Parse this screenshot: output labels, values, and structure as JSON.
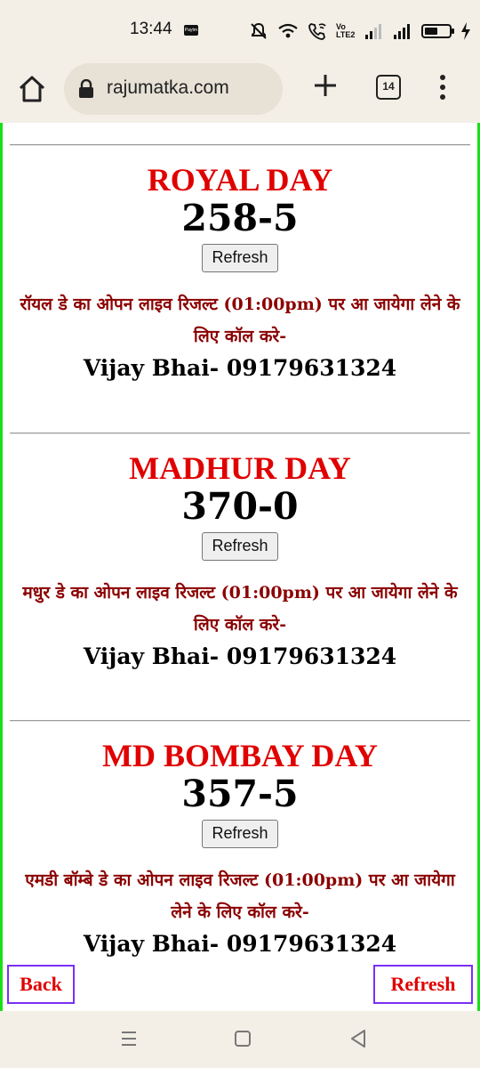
{
  "status_bar": {
    "time": "13:44",
    "paytm_badge": "Paytm",
    "volte": "Vo LTE2",
    "icons": [
      "paytm-icon",
      "mute-icon",
      "wifi-icon",
      "wifi-call-icon",
      "volte-icon",
      "signal-icon",
      "signal-icon",
      "battery-icon",
      "charging-icon"
    ]
  },
  "browser": {
    "url": "rajumatka.com",
    "tab_count": "14",
    "icons": [
      "home-icon",
      "lock-icon",
      "new-tab-plus-icon",
      "tab-switcher-icon",
      "overflow-menu-icon"
    ]
  },
  "games": [
    {
      "name": "ROYAL DAY",
      "result": "258-5",
      "refresh_label": "Refresh",
      "info": "रॉयल डे का ओपन लाइव रिजल्ट (01:00pm) पर आ जायेगा लेने के लिए कॉल करे-",
      "contact": "Vijay Bhai- 09179631324"
    },
    {
      "name": "MADHUR DAY",
      "result": "370-0",
      "refresh_label": "Refresh",
      "info": "मधुर डे का ओपन लाइव रिजल्ट (01:00pm) पर आ जायेगा लेने के लिए कॉल करे-",
      "contact": "Vijay Bhai- 09179631324"
    },
    {
      "name": "MD BOMBAY DAY",
      "result": "357-5",
      "refresh_label": "Refresh",
      "info": "एमडी बॉम्बे डे का ओपन लाइव रिजल्ट (01:00pm) पर आ जायेगा लेने के लिए कॉल करे-",
      "contact": "Vijay Bhai- 09179631324"
    }
  ],
  "floating_buttons": {
    "back_label": "Back",
    "refresh_label": "Refresh"
  },
  "colors": {
    "game_title": "#e00000",
    "info_text": "#8b0000",
    "page_border": "#18e018",
    "float_button_border": "#7b2ff7",
    "chrome_background": "#f3efe6"
  },
  "nav_bar": {
    "icons": [
      "recent-apps-icon",
      "home-square-icon",
      "back-triangle-icon"
    ]
  }
}
